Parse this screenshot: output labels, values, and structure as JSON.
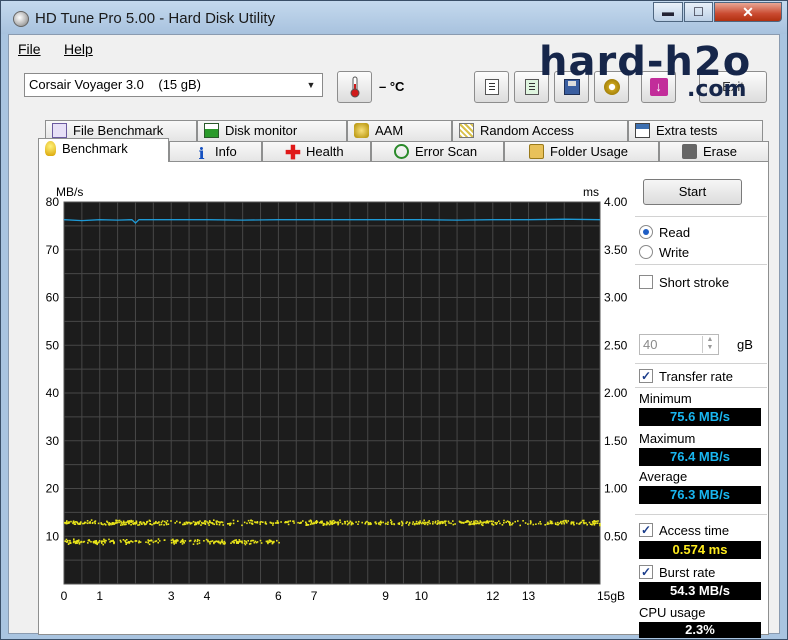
{
  "window": {
    "title": "HD Tune Pro 5.00 - Hard Disk Utility",
    "minimize": "▬",
    "maximize": "☐",
    "close": "✕"
  },
  "menu": [
    {
      "label": "File"
    },
    {
      "label": "Help"
    }
  ],
  "drive": {
    "name": "Corsair Voyager 3.0",
    "size": "(15 gB)",
    "temperature": "– °C"
  },
  "toolbar": {
    "exit_label": "Exit",
    "icons": [
      "copy-icon",
      "copy-screenshot-icon",
      "save-icon",
      "options-icon",
      "download-icon"
    ]
  },
  "watermark": {
    "line1": "hard-h2o",
    "line2": ".com"
  },
  "tabs_top": [
    {
      "label": "File Benchmark",
      "icon": "file-benchmark-icon"
    },
    {
      "label": "Disk monitor",
      "icon": "disk-monitor-icon"
    },
    {
      "label": "AAM",
      "icon": "aam-icon"
    },
    {
      "label": "Random Access",
      "icon": "random-access-icon"
    },
    {
      "label": "Extra tests",
      "icon": "extra-tests-icon"
    }
  ],
  "tabs_bottom": [
    {
      "label": "Benchmark",
      "icon": "benchmark-icon",
      "active": true
    },
    {
      "label": "Info",
      "icon": "info-icon"
    },
    {
      "label": "Health",
      "icon": "health-icon"
    },
    {
      "label": "Error Scan",
      "icon": "error-scan-icon"
    },
    {
      "label": "Folder Usage",
      "icon": "folder-usage-icon"
    },
    {
      "label": "Erase",
      "icon": "erase-icon"
    }
  ],
  "controls": {
    "start_label": "Start",
    "read_label": "Read",
    "write_label": "Write",
    "mode": "read",
    "short_stroke_label": "Short stroke",
    "short_stroke_checked": false,
    "short_stroke_value": "40",
    "short_stroke_unit": "gB",
    "transfer_rate_label": "Transfer rate",
    "transfer_rate_checked": true,
    "access_time_label": "Access time",
    "access_time_checked": true,
    "burst_rate_label": "Burst rate",
    "burst_rate_checked": true,
    "cpu_usage_label": "CPU usage"
  },
  "results": {
    "minimum_label": "Minimum",
    "minimum": "75.6 MB/s",
    "maximum_label": "Maximum",
    "maximum": "76.4 MB/s",
    "average_label": "Average",
    "average": "76.3 MB/s",
    "access_time": "0.574 ms",
    "burst_rate": "54.3 MB/s",
    "cpu_usage": "2.3%"
  },
  "colors": {
    "plot_bg": "#1c1c1c",
    "grid": "#474747",
    "transfer_line": "#1e9ad6",
    "access_dots": "#e8e41a",
    "value_cyan": "#19b6f0",
    "value_yellow": "#ffec1e"
  },
  "chart_data": {
    "type": "line",
    "left_unit": "MB/s",
    "right_unit": "ms",
    "x_unit": "gB",
    "xlim": [
      0,
      15
    ],
    "ylim_left": [
      0,
      80
    ],
    "ylim_right": [
      0,
      4.0
    ],
    "x_ticks": [
      "0",
      "1",
      "3",
      "4",
      "6",
      "7",
      "9",
      "10",
      "12",
      "13",
      "15gB"
    ],
    "x_tick_values": [
      0,
      1,
      3,
      4,
      6,
      7,
      9,
      10,
      12,
      13,
      15
    ],
    "y_ticks_left": [
      "80",
      "70",
      "60",
      "50",
      "40",
      "30",
      "20",
      "10"
    ],
    "y_ticks_right": [
      "4.00",
      "3.50",
      "3.00",
      "2.50",
      "2.00",
      "1.50",
      "1.00",
      "0.50"
    ],
    "grid": true,
    "series": [
      {
        "axis": "left",
        "x": [
          0,
          0.5,
          1,
          1.5,
          1.9,
          2.0,
          2.1,
          3,
          4,
          5,
          6,
          7,
          8,
          9,
          10,
          11,
          12,
          13,
          14,
          15
        ],
        "values": [
          76.3,
          76.1,
          76.3,
          76.2,
          76.3,
          75.6,
          76.3,
          76.3,
          76.3,
          76.2,
          76.3,
          76.3,
          76.3,
          76.3,
          76.3,
          76.2,
          76.3,
          76.3,
          76.4,
          76.3
        ]
      },
      {
        "axis": "right",
        "kind": "scatter",
        "clusters": [
          {
            "x_range": [
              0,
              15
            ],
            "y_center": 0.65,
            "y_spread": 0.03
          },
          {
            "x_range": [
              0,
              6
            ],
            "y_center": 0.45,
            "y_spread": 0.03
          }
        ]
      }
    ]
  }
}
